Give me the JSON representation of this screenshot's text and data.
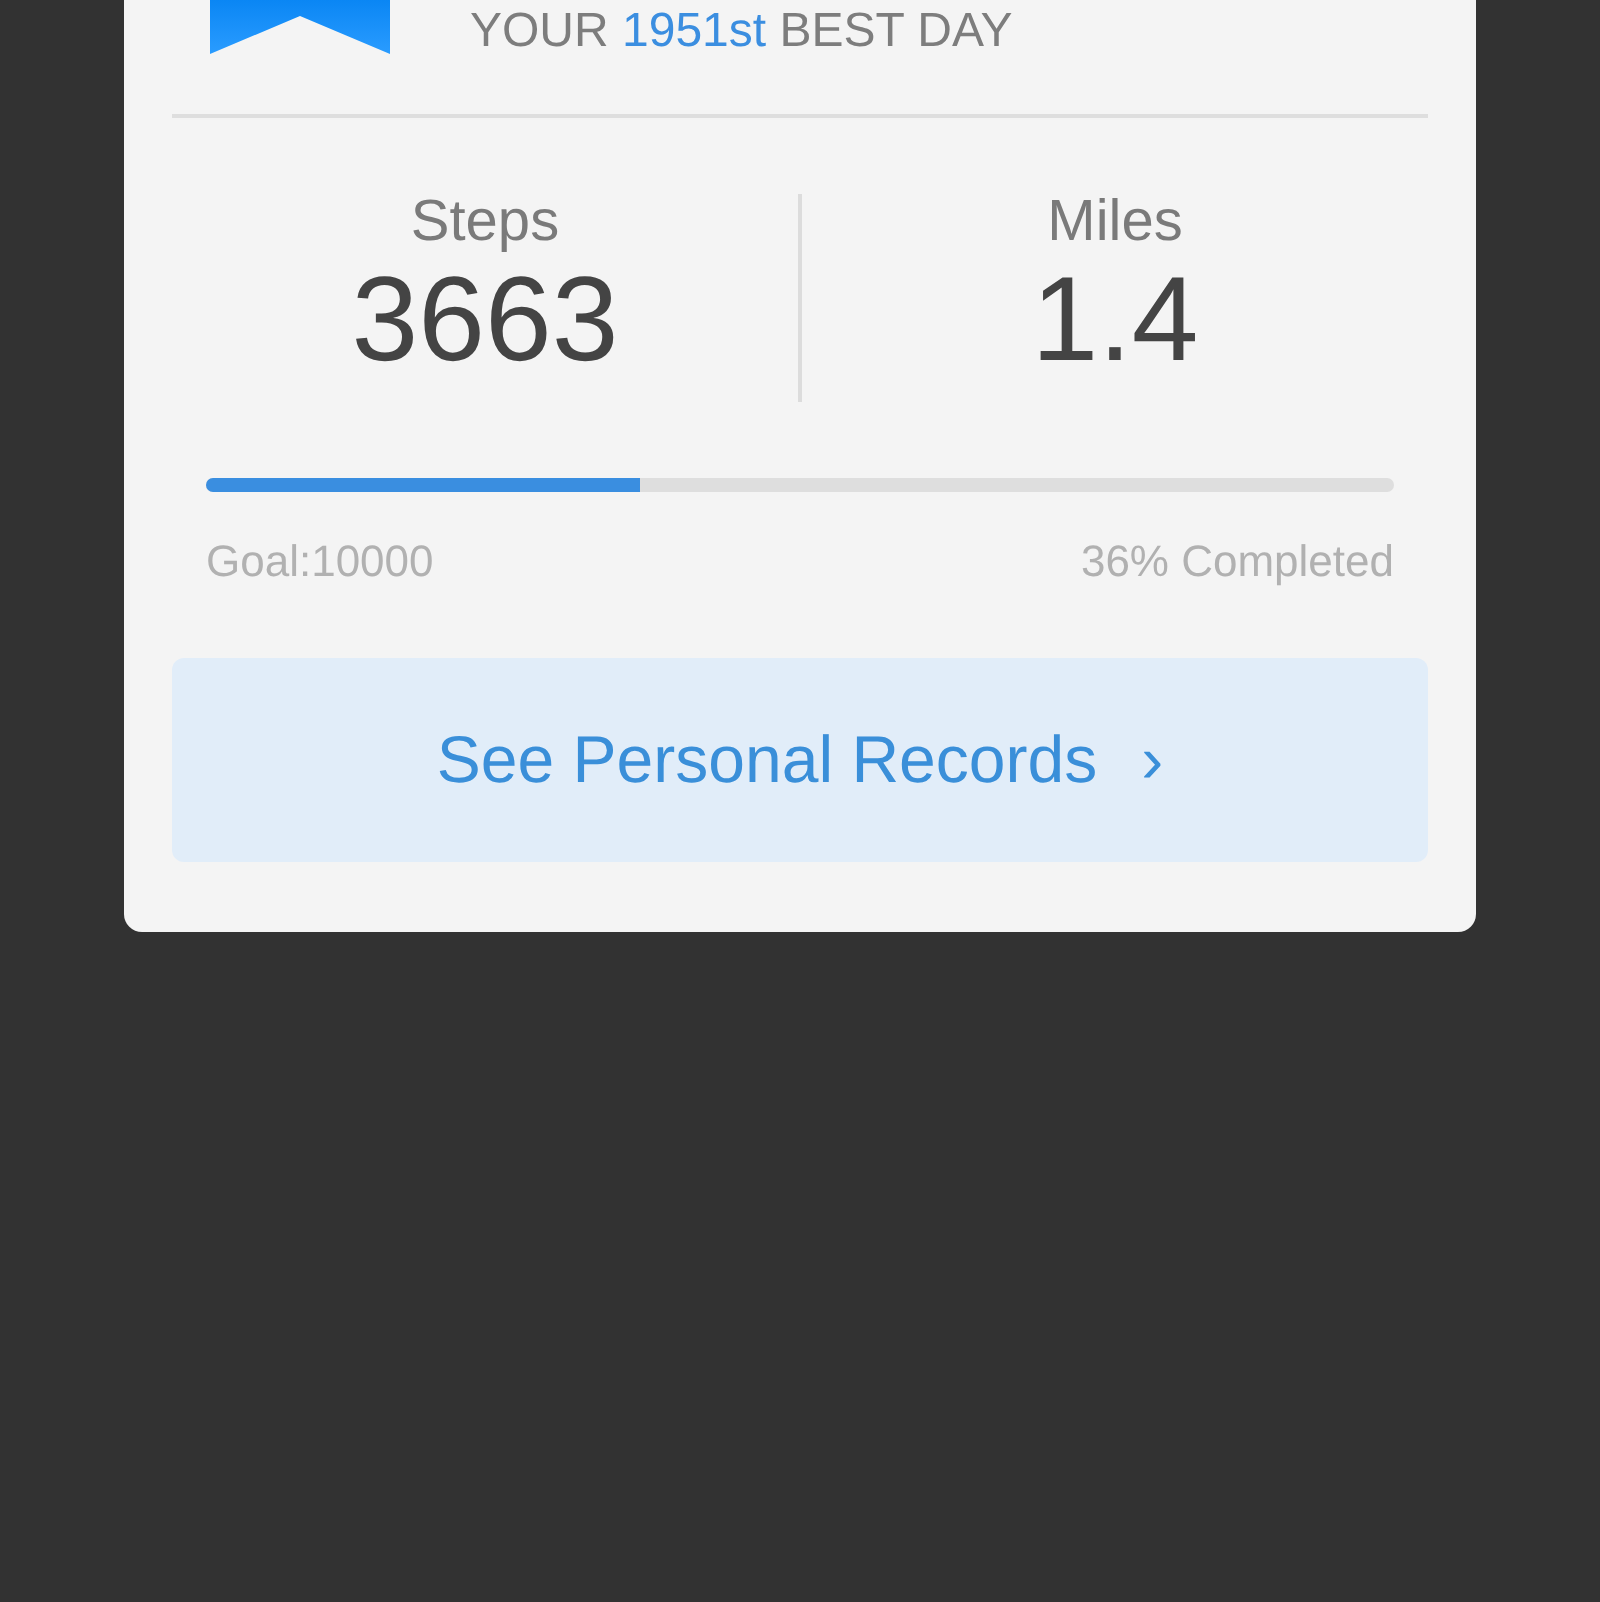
{
  "headline": {
    "prefix": "YOUR",
    "highlight": "1951st",
    "suffix": "BEST DAY"
  },
  "stats": [
    {
      "label": "Steps",
      "value": "3663"
    },
    {
      "label": "Miles",
      "value": "1.4"
    }
  ],
  "progress": {
    "level": 0.366,
    "goal": "Goal:10000",
    "completed": "36% Completed"
  },
  "records_button": {
    "label": "See Personal Records",
    "chevron": "›"
  }
}
